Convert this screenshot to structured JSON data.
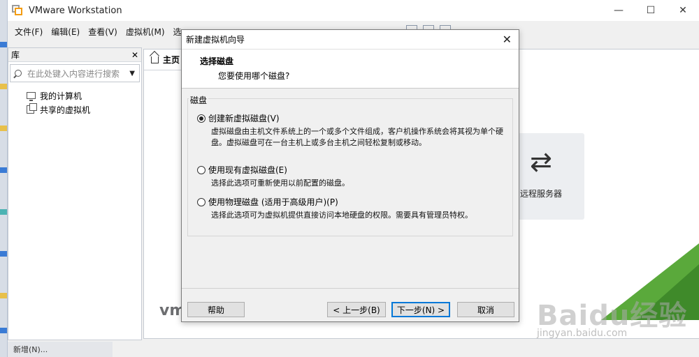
{
  "window": {
    "title": "VMware Workstation",
    "min_glyph": "—",
    "max_glyph": "☐",
    "close_glyph": "✕"
  },
  "menu": [
    "文件(F)",
    "编辑(E)",
    "查看(V)",
    "虚拟机(M)",
    "选"
  ],
  "library": {
    "title": "库",
    "close_glyph": "✕",
    "search_placeholder": "在此处键入内容进行搜索",
    "items": [
      {
        "label": "我的计算机",
        "icon": "computer-icon"
      },
      {
        "label": "共享的虚拟机",
        "icon": "shared-vm-icon"
      }
    ]
  },
  "home": {
    "tab_label": "主页",
    "remote_label": "远程服务器",
    "remote_arrows": "⇄",
    "logo_fragment": "vm"
  },
  "bottom_partial": "新增(N)...",
  "dialog": {
    "title": "新建虚拟机向导",
    "close_glyph": "✕",
    "heading": "选择磁盘",
    "subheading": "您要使用哪个磁盘?",
    "group_label": "磁盘",
    "options": [
      {
        "label": "创建新虚拟磁盘(V)",
        "selected": true,
        "description": "虚拟磁盘由主机文件系统上的一个或多个文件组成，客户机操作系统会将其视为单个硬盘。虚拟磁盘可在一台主机上或多台主机之间轻松复制或移动。"
      },
      {
        "label": "使用现有虚拟磁盘(E)",
        "selected": false,
        "description": "选择此选项可重新使用以前配置的磁盘。"
      },
      {
        "label": "使用物理磁盘 (适用于高级用户)(P)",
        "selected": false,
        "description": "选择此选项可为虚拟机提供直接访问本地硬盘的权限。需要具有管理员特权。"
      }
    ],
    "buttons": {
      "help": "帮助",
      "back": "< 上一步(B)",
      "next": "下一步(N) >",
      "cancel": "取消"
    }
  },
  "watermark": {
    "main": "Baidu经验",
    "sub": "jingyan.baidu.com"
  },
  "colors": {
    "accent": "#0078d7",
    "vmware_orange": "#f39c12",
    "green_corner": "#5aa93b"
  }
}
